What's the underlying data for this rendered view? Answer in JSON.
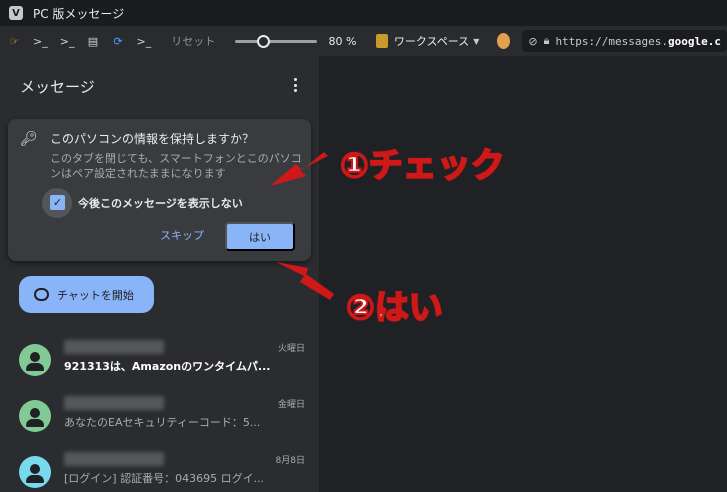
{
  "window": {
    "title": "PC 版メッセージ",
    "logo": "V"
  },
  "toolbar": {
    "reset_label": "リセット",
    "zoom_value": "80 %",
    "zoom_fraction": 0.8,
    "workspace_label": "ワークスペース",
    "url_prefix": "https://messages.",
    "url_host": "google.c"
  },
  "sidebar": {
    "title": "メッセージ"
  },
  "card": {
    "title": "このパソコンの情報を保持しますか？",
    "body": "このタブを閉じても、スマートフォンとこのパソコンはペア設定されたままになります",
    "checkbox_label": "今後このメッセージを表示しない",
    "checkbox_checked": true,
    "skip_label": "スキップ",
    "yes_label": "はい"
  },
  "start_chat": {
    "label": "チャットを開始"
  },
  "conversations": [
    {
      "date": "火曜日",
      "preview": "921313は、Amazonのワンタイムパ...",
      "unread": true,
      "avatar_color": "#81c995"
    },
    {
      "date": "金曜日",
      "preview": "あなたのEAセキュリティーコード：5...",
      "unread": false,
      "avatar_color": "#81c995"
    },
    {
      "date": "8月8日",
      "preview": "[ログイン] 認証番号：043695 ログイ...",
      "unread": false,
      "avatar_color": "#78d9ec"
    }
  ],
  "annotations": {
    "step1": "①チェック",
    "step2": "②はい",
    "color": "#d01818"
  }
}
